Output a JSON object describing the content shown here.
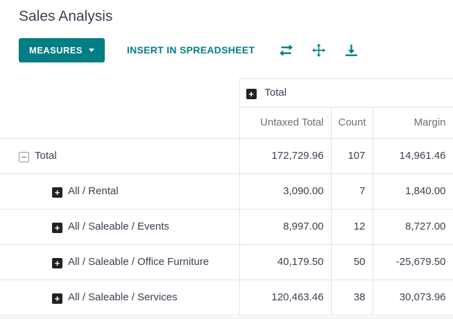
{
  "page": {
    "title": "Sales Analysis"
  },
  "toolbar": {
    "measures_label": "MEASURES",
    "insert_label": "INSERT IN SPREADSHEET"
  },
  "icons": {
    "expand_glyph": "+",
    "collapse_glyph": "−"
  },
  "colors": {
    "accent": "#017e84",
    "border": "#dee2e6",
    "text": "#374151",
    "muted": "#69707a"
  },
  "table": {
    "column_group": {
      "label": "Total"
    },
    "columns": [
      "Untaxed Total",
      "Count",
      "Margin"
    ],
    "rows": [
      {
        "label": "Total",
        "state": "expanded",
        "indent": 0,
        "values": [
          "172,729.96",
          "107",
          "14,961.46"
        ]
      },
      {
        "label": "All / Rental",
        "state": "collapsed",
        "indent": 1,
        "values": [
          "3,090.00",
          "7",
          "1,840.00"
        ]
      },
      {
        "label": "All / Saleable / Events",
        "state": "collapsed",
        "indent": 1,
        "values": [
          "8,997.00",
          "12",
          "8,727.00"
        ]
      },
      {
        "label": "All / Saleable / Office Furniture",
        "state": "collapsed",
        "indent": 1,
        "values": [
          "40,179.50",
          "50",
          "-25,679.50"
        ]
      },
      {
        "label": "All / Saleable / Services",
        "state": "collapsed",
        "indent": 1,
        "values": [
          "120,463.46",
          "38",
          "30,073.96"
        ]
      }
    ]
  }
}
